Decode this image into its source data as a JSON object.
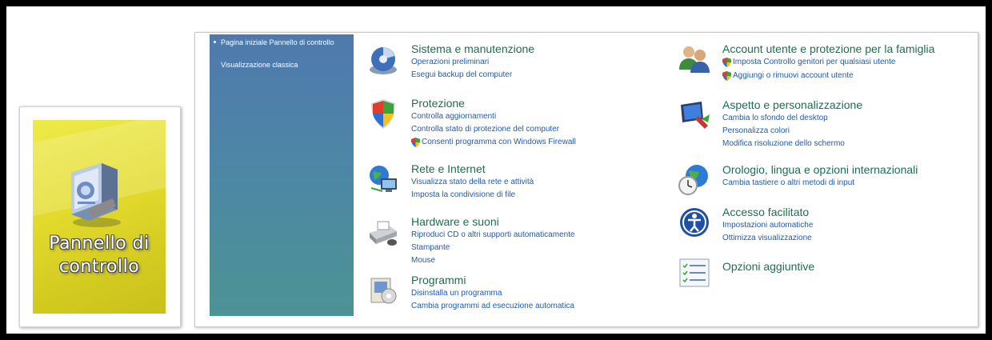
{
  "tile": {
    "label_line1": "Pannello di",
    "label_line2": "controllo",
    "icon": "control-panel-icon"
  },
  "sidebar": {
    "items": [
      {
        "label": "Pagina iniziale Pannello di controllo"
      },
      {
        "label": "Visualizzazione classica"
      }
    ]
  },
  "categories": [
    {
      "key": "sistema",
      "title": "Sistema e manutenzione",
      "icon": "system-maintenance-icon",
      "links": [
        "Operazioni preliminari",
        "Esegui backup del computer"
      ]
    },
    {
      "key": "protezione",
      "title": "Protezione",
      "icon": "security-shield-icon",
      "links": [
        "Controlla aggiornamenti",
        "Controlla stato di protezione del computer",
        "Consenti programma con Windows Firewall"
      ]
    },
    {
      "key": "rete",
      "title": "Rete e Internet",
      "icon": "network-internet-icon",
      "links": [
        "Visualizza stato della rete e attività",
        "Imposta la condivisione di file"
      ]
    },
    {
      "key": "hardware",
      "title": "Hardware e suoni",
      "icon": "hardware-sound-icon",
      "links": [
        "Riproduci CD o altri supporti automaticamente",
        "Stampante",
        "Mouse"
      ]
    },
    {
      "key": "programmi",
      "title": "Programmi",
      "icon": "programs-icon",
      "links": [
        "Disinstalla un programma",
        "Cambia programmi ad esecuzione automatica"
      ]
    },
    {
      "key": "account",
      "title": "Account utente e protezione per la famiglia",
      "icon": "user-accounts-icon",
      "links": [
        "Imposta Controllo genitori per qualsiasi utente",
        "Aggiungi o rimuovi account utente"
      ]
    },
    {
      "key": "aspetto",
      "title": "Aspetto e personalizzazione",
      "icon": "appearance-icon",
      "links": [
        "Cambia lo sfondo del desktop",
        "Personalizza colori",
        "Modifica risoluzione dello schermo"
      ]
    },
    {
      "key": "orologio",
      "title": "Orologio, lingua e opzioni internazionali",
      "icon": "clock-globe-icon",
      "links": [
        "Cambia tastiere o altri metodi di input"
      ]
    },
    {
      "key": "accesso",
      "title": "Accesso facilitato",
      "icon": "ease-of-access-icon",
      "links": [
        "Impostazioni automatiche",
        "Ottimizza visualizzazione"
      ]
    },
    {
      "key": "opzioni",
      "title": "Opzioni aggiuntive",
      "icon": "additional-options-icon",
      "links": []
    }
  ],
  "colors": {
    "title_green": "#1d6e52",
    "link_blue": "#1e5bb3",
    "tile_yellow": "#e3dc2e",
    "sidebar_blue": "#4f79ad"
  }
}
